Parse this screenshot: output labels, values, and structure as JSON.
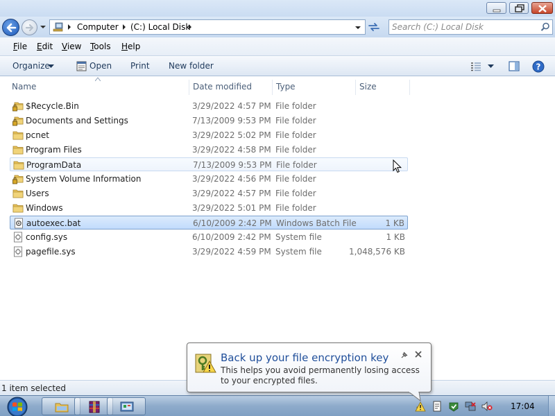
{
  "window": {
    "controls": [
      "minimize",
      "maximize",
      "close"
    ]
  },
  "navigation": {
    "breadcrumbs": [
      "Computer",
      "(C:) Local Disk"
    ],
    "search_placeholder": "Search (C:) Local Disk"
  },
  "menu": {
    "items": [
      {
        "label": "File",
        "accel": "F",
        "rest": "ile"
      },
      {
        "label": "Edit",
        "accel": "E",
        "rest": "dit"
      },
      {
        "label": "View",
        "accel": "V",
        "rest": "iew"
      },
      {
        "label": "Tools",
        "accel": "T",
        "rest": "ools"
      },
      {
        "label": "Help",
        "accel": "H",
        "rest": "elp"
      }
    ]
  },
  "toolbar": {
    "organize": "Organize",
    "open": "Open",
    "print": "Print",
    "new_folder": "New folder",
    "icons": [
      "views-icon",
      "chevron-down-icon",
      "preview-pane-icon",
      "help-icon"
    ]
  },
  "columns": {
    "name": "Name",
    "date": "Date modified",
    "type": "Type",
    "size": "Size"
  },
  "files": [
    {
      "name": "$Recycle.Bin",
      "date": "3/29/2022 4:57 PM",
      "type": "File folder",
      "size": "",
      "icon": "locked-folder-icon"
    },
    {
      "name": "Documents and Settings",
      "date": "7/13/2009 9:53 PM",
      "type": "File folder",
      "size": "",
      "icon": "locked-folder-icon"
    },
    {
      "name": "pcnet",
      "date": "3/29/2022 5:02 PM",
      "type": "File folder",
      "size": "",
      "icon": "folder-icon"
    },
    {
      "name": "Program Files",
      "date": "3/29/2022 4:58 PM",
      "type": "File folder",
      "size": "",
      "icon": "folder-icon"
    },
    {
      "name": "ProgramData",
      "date": "7/13/2009 9:53 PM",
      "type": "File folder",
      "size": "",
      "icon": "folder-icon"
    },
    {
      "name": "System Volume Information",
      "date": "3/29/2022 4:56 PM",
      "type": "File folder",
      "size": "",
      "icon": "locked-folder-icon"
    },
    {
      "name": "Users",
      "date": "3/29/2022 4:57 PM",
      "type": "File folder",
      "size": "",
      "icon": "folder-icon"
    },
    {
      "name": "Windows",
      "date": "3/29/2022 5:01 PM",
      "type": "File folder",
      "size": "",
      "icon": "folder-icon"
    },
    {
      "name": "autoexec.bat",
      "date": "6/10/2009 2:42 PM",
      "type": "Windows Batch File",
      "size": "1 KB",
      "icon": "batch-file-icon"
    },
    {
      "name": "config.sys",
      "date": "6/10/2009 2:42 PM",
      "type": "System file",
      "size": "1 KB",
      "icon": "system-file-icon"
    },
    {
      "name": "pagefile.sys",
      "date": "3/29/2022 4:59 PM",
      "type": "System file",
      "size": "1,048,576 KB",
      "icon": "system-file-icon"
    }
  ],
  "hovered_row": "ProgramData",
  "selected_row": "autoexec.bat",
  "status": {
    "text": "1 item selected"
  },
  "notification": {
    "title": "Back up your file encryption key",
    "body": "This helps you avoid permanently losing access to your encrypted files."
  },
  "taskbar": {
    "pinned": [
      "explorer-icon",
      "winrar-icon",
      "control-panel-icon"
    ],
    "tray_icons": [
      "encryption-warning-icon",
      "notes-icon",
      "action-center-icon",
      "network-icon",
      "volume-muted-icon"
    ],
    "clock": "17:04"
  },
  "colors": {
    "accent": "#1f4e9a",
    "selection": "#c1dbfc",
    "hover": "#eef4fc",
    "folder": "#e8c25a"
  }
}
